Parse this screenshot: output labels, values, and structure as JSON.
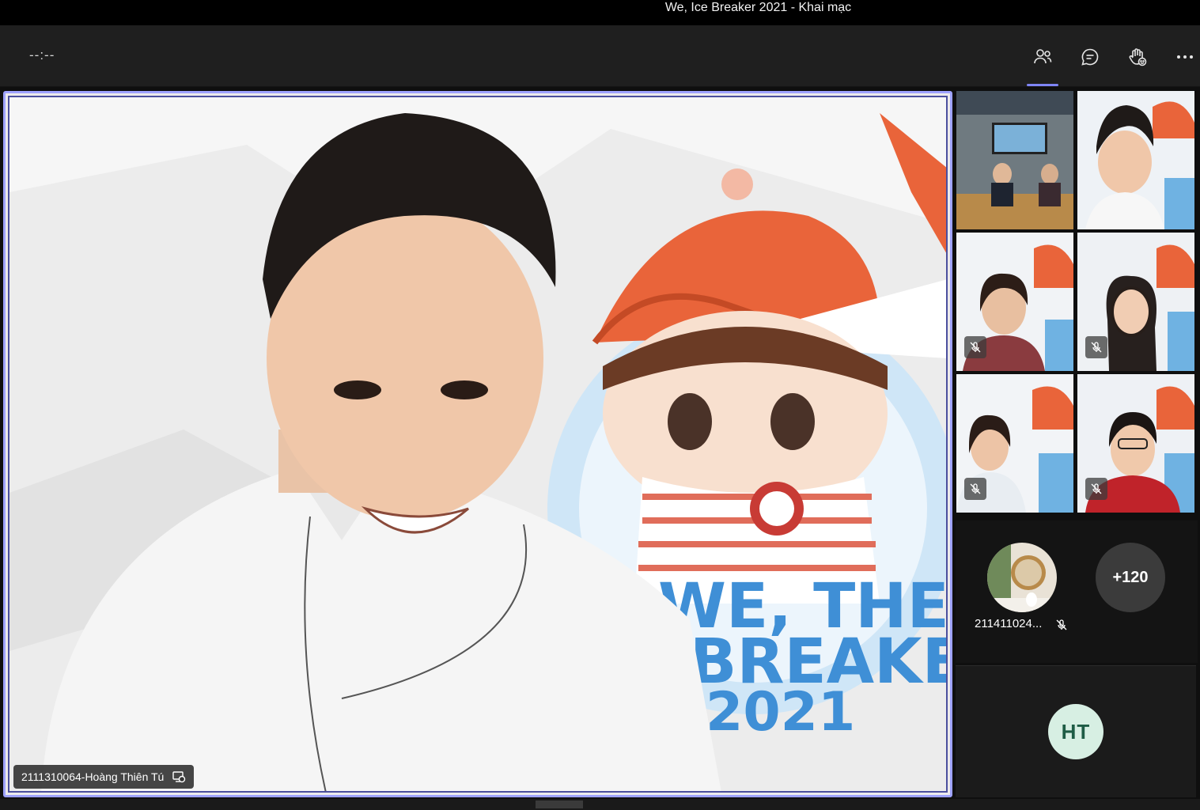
{
  "window": {
    "title": "We, Ice Breaker 2021 - Khai mạc"
  },
  "toolbar": {
    "timer": "--:--",
    "buttons": [
      {
        "icon": "people-icon",
        "active": true
      },
      {
        "icon": "chat-icon",
        "active": false
      },
      {
        "icon": "raise-hand-icon",
        "active": false
      },
      {
        "icon": "more-options-icon",
        "active": false
      }
    ]
  },
  "main_video": {
    "participant_name": "2111310064-Hoàng Thiên Tú",
    "background_text": [
      "WE, THE",
      "BREAKER",
      "2021"
    ]
  },
  "gallery": {
    "tiles": [
      {
        "muted": false
      },
      {
        "muted": false
      },
      {
        "muted": true
      },
      {
        "muted": true
      },
      {
        "muted": true
      },
      {
        "muted": true
      }
    ],
    "overflow": {
      "participant_name": "211411024...",
      "participant_muted": true,
      "more_count": "+120"
    }
  },
  "self_view": {
    "initials": "HT"
  },
  "colors": {
    "accent": "#7f85f5",
    "active_border": "#9ea2ff",
    "titlebar": "#000000",
    "toolbar": "#1f1f1f"
  }
}
